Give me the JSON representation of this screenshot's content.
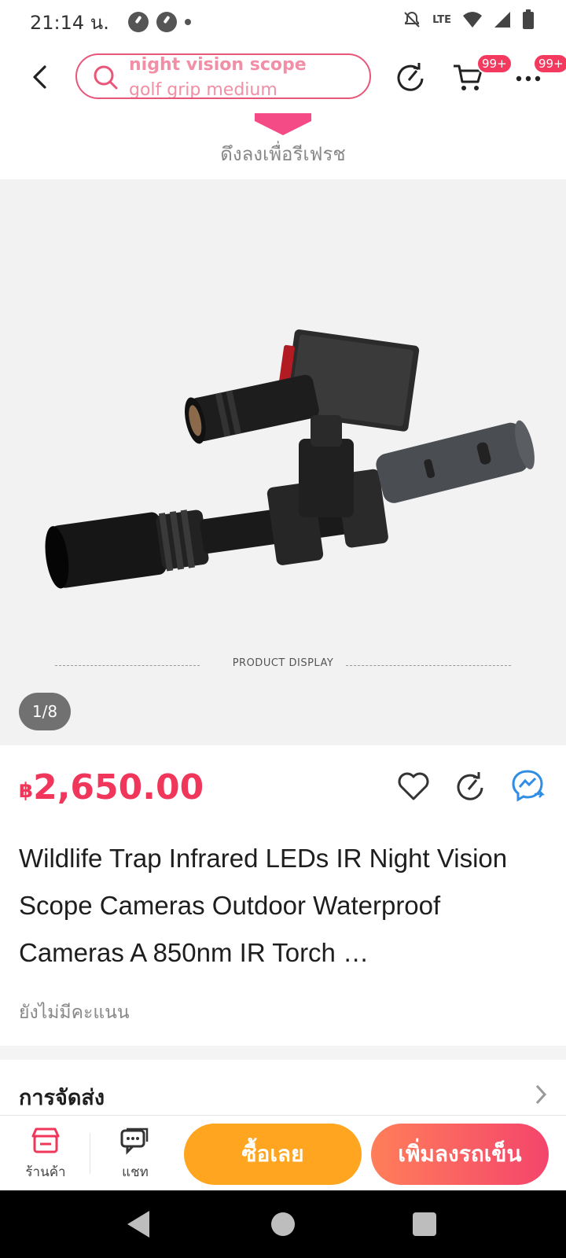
{
  "status_bar": {
    "time": "21:14 น.",
    "network_label": "LTE"
  },
  "header": {
    "search_line1": "night vision scope",
    "search_line2": "golf grip medium",
    "cart_badge": "99+",
    "more_badge": "99+"
  },
  "pull_refresh": {
    "text": "ดึงลงเพื่อรีเฟรช"
  },
  "gallery": {
    "caption": "PRODUCT DISPLAY",
    "indicator": "1/8"
  },
  "product": {
    "currency_symbol": "฿",
    "price": "2,650.00",
    "title": "Wildlife Trap Infrared LEDs IR Night Vision Scope Cameras Outdoor Waterproof Cameras A 850nm IR Torch …",
    "rating_text": "ยังไม่มีคะแนน"
  },
  "shipping": {
    "label": "การจัดส่ง"
  },
  "bottom_bar": {
    "shop_label": "ร้านค้า",
    "chat_label": "แชท",
    "buy_now": "ซื้อเลย",
    "add_to_cart": "เพิ่มลงรถเข็น"
  },
  "colors": {
    "accent": "#f0375b",
    "buy_now": "#ffa51f",
    "cart_gradient_start": "#ff7e59",
    "cart_gradient_end": "#f4456c"
  }
}
